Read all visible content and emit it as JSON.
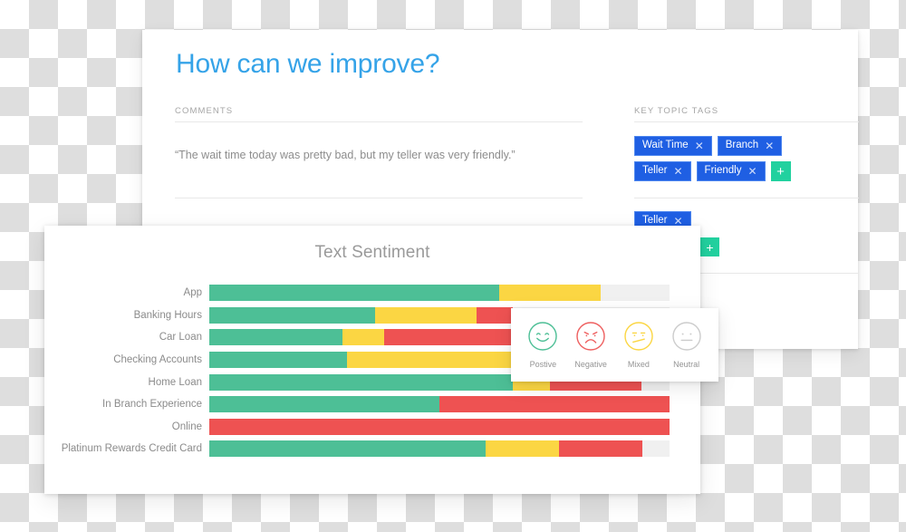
{
  "improve_card": {
    "title": "How can we improve?",
    "comments_header": "COMMENTS",
    "tags_header": "KEY TOPIC TAGS",
    "comments": [
      "“The wait time today was pretty bad, but my teller was very friendly.”",
      "",
      ""
    ],
    "tag_rows": [
      [
        "Wait Time",
        "Branch"
      ],
      [
        "Teller",
        "Friendly"
      ],
      [
        "Teller"
      ],
      [],
      [],
      []
    ],
    "tag_close_glyph": "✕",
    "add_tag_label": "+",
    "tag_color": "#1f5fe3",
    "add_button_color": "#22d19f",
    "title_color": "#35a3e8"
  },
  "sentiment_card": {
    "title": "Text Sentiment",
    "legend": {
      "items": [
        {
          "label": "Postive",
          "icon": "smiley-positive-icon",
          "color": "#4dbf96"
        },
        {
          "label": "Negative",
          "icon": "smiley-negative-icon",
          "color": "#ee5f5f"
        },
        {
          "label": "Mixed",
          "icon": "smiley-mixed-icon",
          "color": "#fbd643"
        },
        {
          "label": "Neutral",
          "icon": "smiley-neutral-icon",
          "color": "#cccccc"
        }
      ]
    }
  },
  "chart_data": {
    "type": "bar",
    "title": "Text Sentiment",
    "subtype": "stacked-horizontal-100pct",
    "xlabel": "",
    "ylabel": "",
    "xlim": [
      0,
      100
    ],
    "grid": false,
    "legend_position": "floating-overlay-bottom-right",
    "series": [
      {
        "name": "Postive",
        "color": "#4dbf96",
        "values": [
          63,
          36,
          29,
          30,
          66,
          50,
          0,
          60
        ]
      },
      {
        "name": "Mixed",
        "color": "#fbd643",
        "values": [
          22,
          22,
          9,
          37,
          8,
          0,
          0,
          16
        ]
      },
      {
        "name": "Negative",
        "color": "#ee5252",
        "values": [
          0,
          8,
          28,
          0,
          20,
          50,
          100,
          18
        ]
      },
      {
        "name": "Neutral",
        "color": "#f0f0f0",
        "values": [
          15,
          34,
          34,
          33,
          6,
          0,
          0,
          6
        ]
      }
    ],
    "categories": [
      "App",
      "Banking Hours",
      "Car Loan",
      "Checking Accounts",
      "Home Loan",
      "In Branch Experience",
      "Online",
      "Platinum Rewards Credit Card"
    ]
  }
}
